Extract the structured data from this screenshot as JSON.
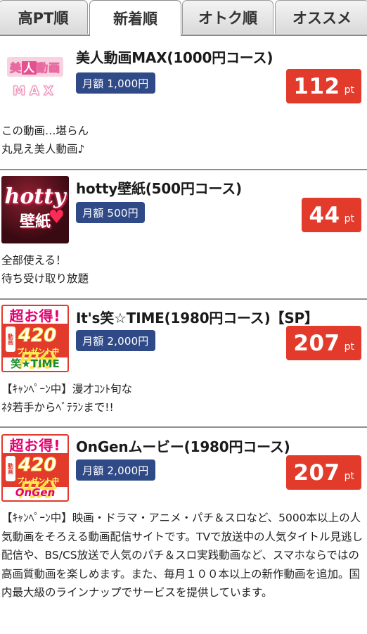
{
  "tabs": [
    {
      "label": "高PT順",
      "active": false
    },
    {
      "label": "新着順",
      "active": true
    },
    {
      "label": "オトク順",
      "active": false
    },
    {
      "label": "オススメ",
      "active": false
    }
  ],
  "items": [
    {
      "title": "美人動画MAX(1000円コース)",
      "price": "月額 1,000円",
      "points": "112",
      "unit": "pt",
      "thumb": {
        "line1": "美人動画",
        "line1_highlight": "人",
        "line2": "MAX"
      },
      "desc": [
        "この動画…堪らん",
        "丸見え美人動画♪"
      ]
    },
    {
      "title": "hotty壁紙(500円コース)",
      "price": "月額 500円",
      "points": "44",
      "unit": "pt",
      "thumb": {
        "line1": "hotty",
        "line2": "壁紙",
        "icon": "heart-icon"
      },
      "desc": [
        "全部使える！",
        "待ち受け取り放題"
      ]
    },
    {
      "title": "It's笑☆TIME(1980円コース)【SP】",
      "price": "月額 2,000円",
      "points": "207",
      "unit": "pt",
      "thumb": {
        "top": "超お得!",
        "phone": "動画",
        "amount": "420円分",
        "sub": "プレゼント中",
        "bottom": "笑★TIME"
      },
      "desc": [
        "【ｷｬﾝﾍﾟｰﾝ中】漫才ｺﾝﾄ旬な",
        "ﾈﾀ若手からﾍﾞﾃﾗﾝまで!!"
      ]
    },
    {
      "title": "OnGenムービー(1980円コース)",
      "price": "月額 2,000円",
      "points": "207",
      "unit": "pt",
      "thumb": {
        "top": "超お得!",
        "phone": "動画",
        "amount": "420円分",
        "sub": "プレゼント中",
        "bottom": "OnGen"
      },
      "desc": [
        "【ｷｬﾝﾍﾟｰﾝ中】映画・ドラマ・アニメ・パチ＆スロなど、5000本以上の人気動画をそろえる動画配信サイトです。TVで放送中の人気タイトル見逃し配信や、BS/CS放送で人気のパチ＆スロ実践動画など、スマホならではの高画質動画を楽しめます。また、毎月１００本以上の新作動画を追加。国内最大級のラインナップでサービスを提供しています。"
      ]
    }
  ],
  "colors": {
    "points_bg": "#e23a2b",
    "price_bg": "#2f4a86",
    "separator": "#8f8f8f"
  }
}
